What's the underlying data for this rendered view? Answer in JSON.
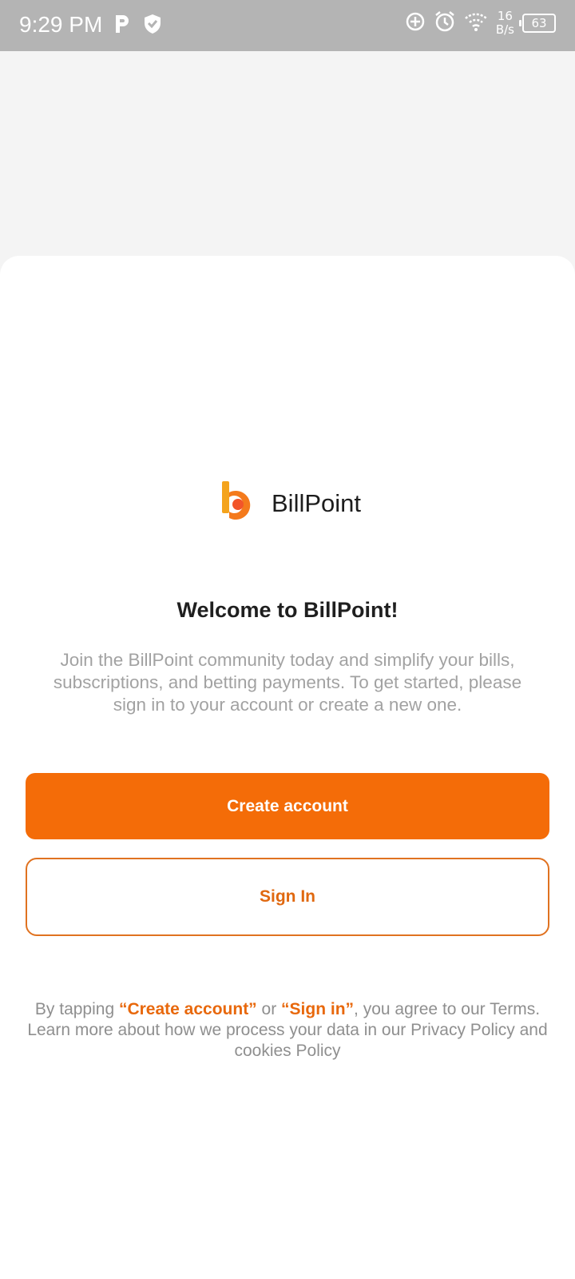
{
  "status_bar": {
    "time": "9:29 PM",
    "speed_value": "16",
    "speed_unit": "B/s",
    "battery": "63"
  },
  "brand": {
    "name": "BillPoint",
    "logo_colors": [
      "#f4a31c",
      "#f2552a"
    ]
  },
  "welcome": {
    "title": "Welcome to BillPoint!",
    "intro": "Join the BillPoint community today and simplify your bills, subscriptions, and betting payments. To get started, please sign in to your account or create a new one."
  },
  "actions": {
    "create_label": "Create account",
    "signin_label": "Sign In"
  },
  "terms": {
    "prefix": "By tapping ",
    "create_link": "“Create account”",
    "or": " or ",
    "signin_link": "“Sign in”",
    "suffix": ", you agree to our Terms. Learn more about how we process your data in our Privacy Policy and cookies Policy"
  },
  "colors": {
    "accent": "#f46c08",
    "status_bar": "#b4b4b4",
    "background": "#f4f4f4"
  }
}
